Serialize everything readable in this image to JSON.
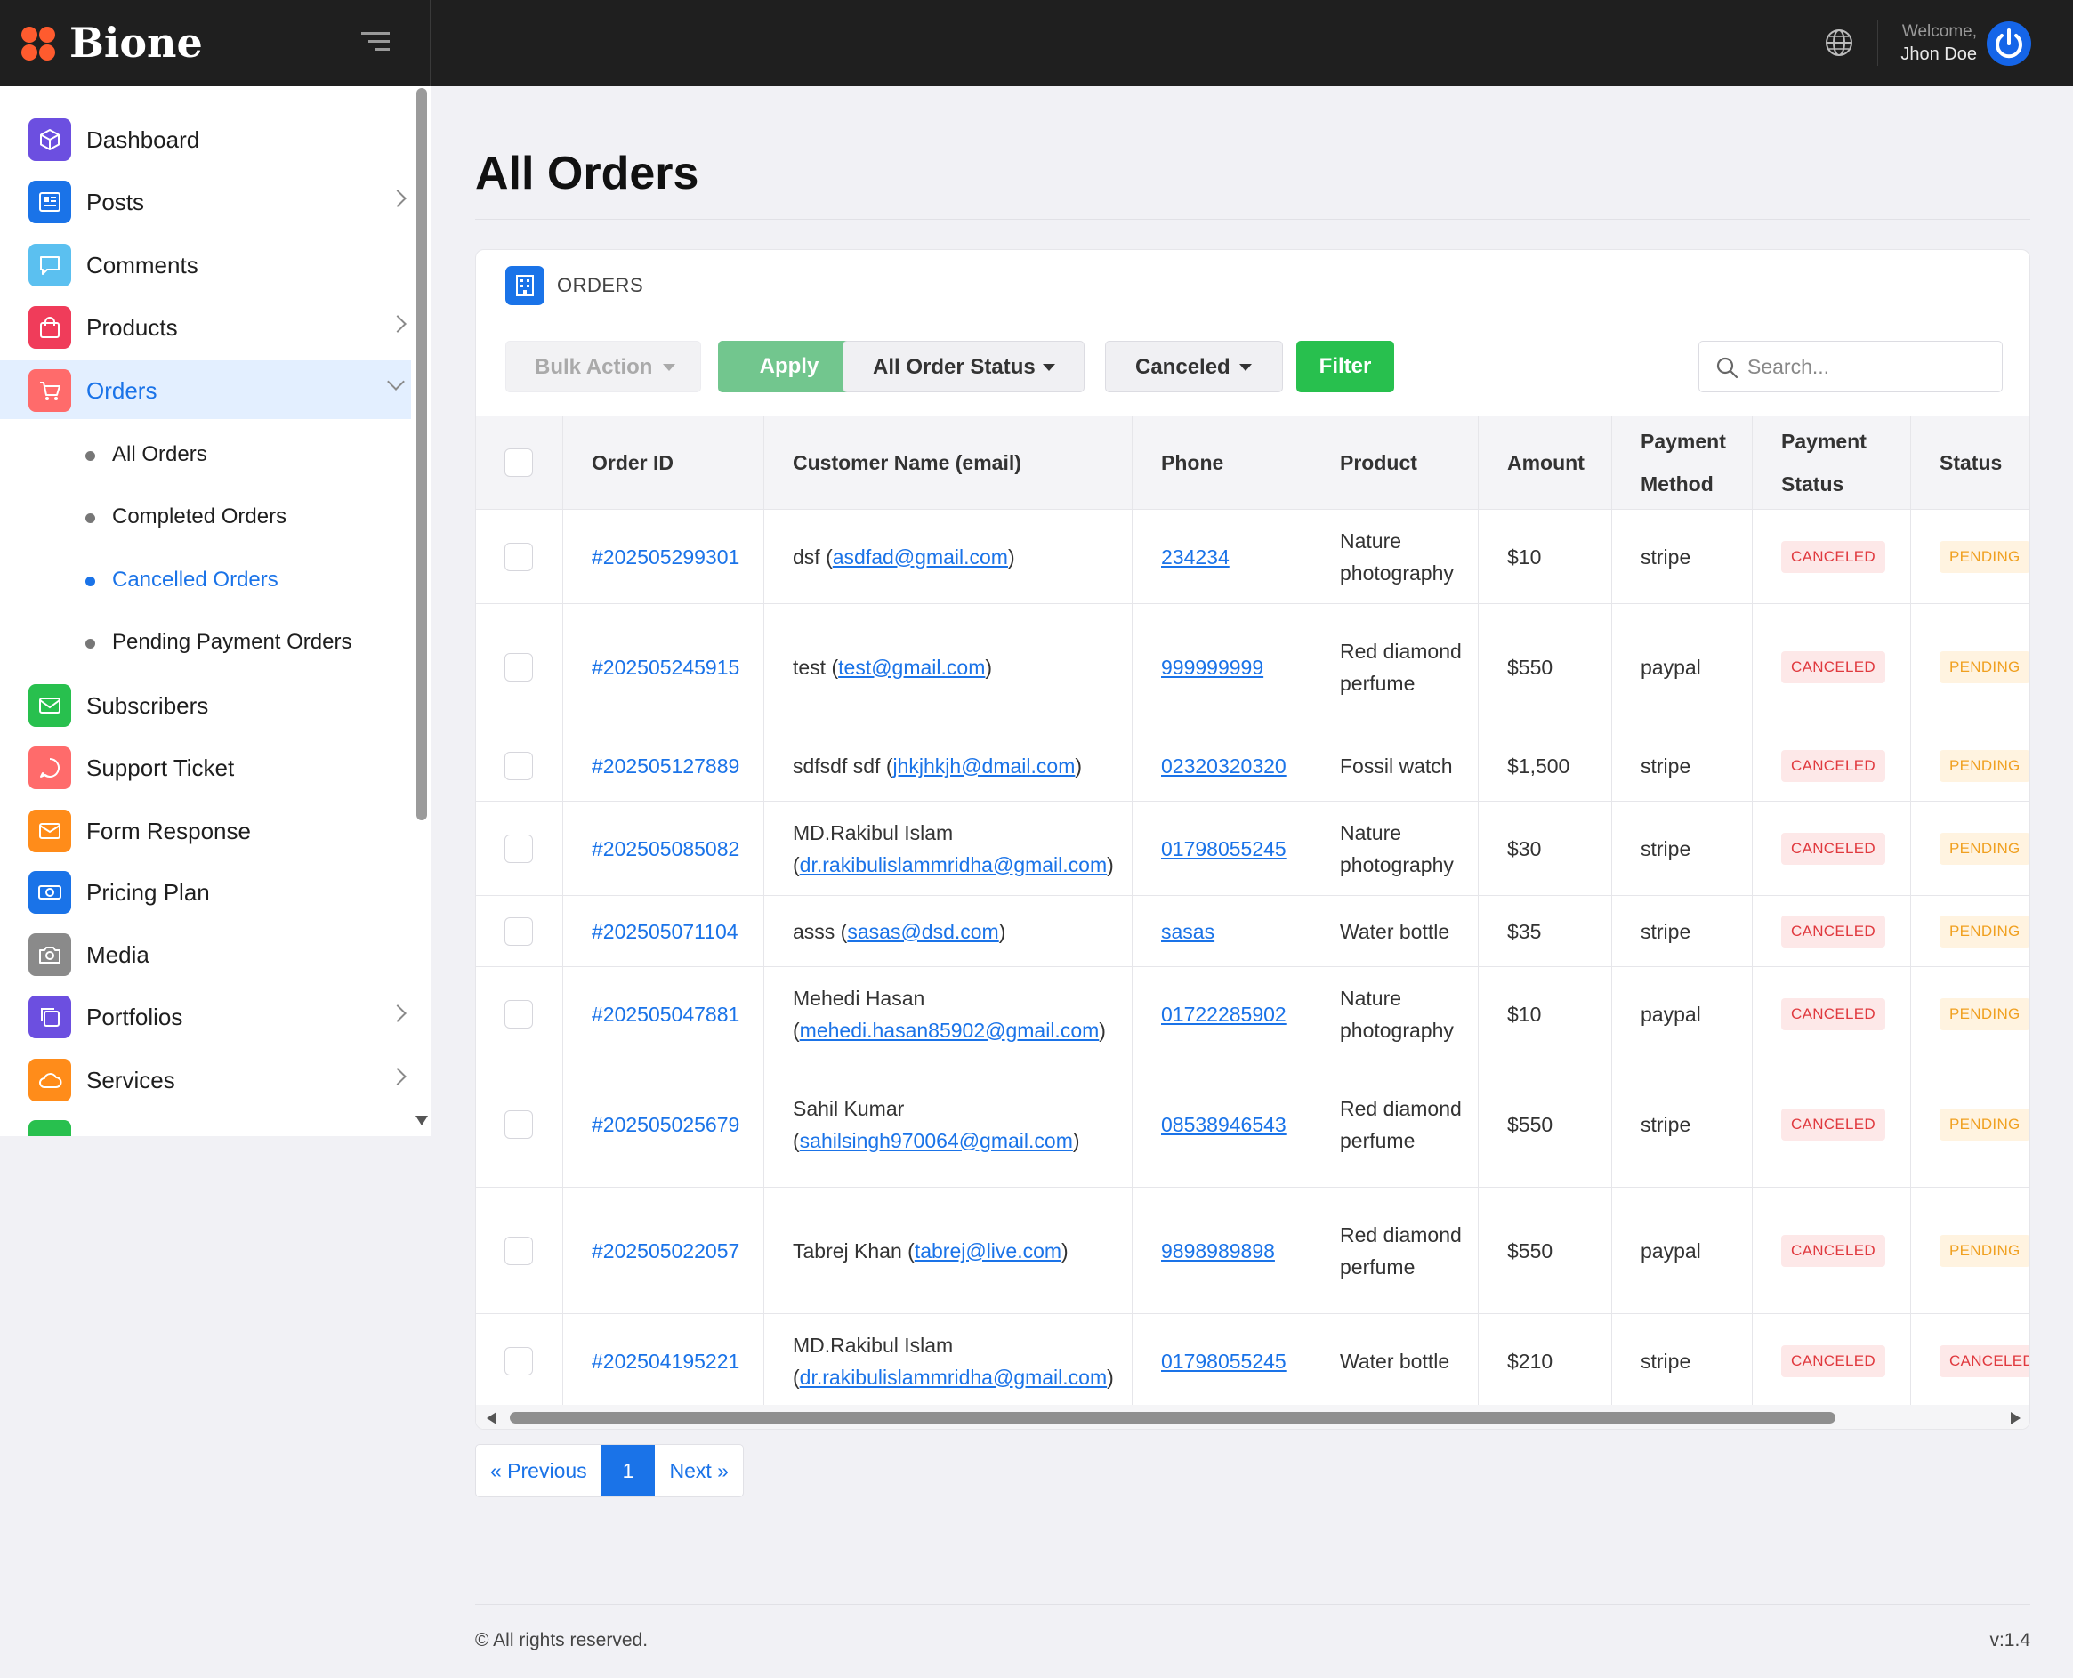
{
  "brand": {
    "name": "Bione"
  },
  "header": {
    "welcome": "Welcome,",
    "user_name": "Jhon Doe"
  },
  "sidebar": {
    "items": [
      {
        "label": "Dashboard",
        "icon": "cube-icon",
        "color": "#6c4fe0"
      },
      {
        "label": "Posts",
        "icon": "newspaper-icon",
        "color": "#1a73e8"
      },
      {
        "label": "Comments",
        "icon": "chat-icon",
        "color": "#5bc0f0"
      },
      {
        "label": "Products",
        "icon": "bag-icon",
        "color": "#f03c5a"
      },
      {
        "label": "Orders",
        "icon": "cart-icon",
        "color": "#ff6b6b"
      },
      {
        "label": "Subscribers",
        "icon": "mail-icon",
        "color": "#28c04e"
      },
      {
        "label": "Support Ticket",
        "icon": "support-icon",
        "color": "#ff6b6b"
      },
      {
        "label": "Form Response",
        "icon": "envelope-icon",
        "color": "#ff8c1a"
      },
      {
        "label": "Pricing Plan",
        "icon": "money-icon",
        "color": "#1a73e8"
      },
      {
        "label": "Media",
        "icon": "camera-icon",
        "color": "#8a8a8a"
      },
      {
        "label": "Portfolios",
        "icon": "copy-icon",
        "color": "#6c4fe0"
      },
      {
        "label": "Services",
        "icon": "cloud-icon",
        "color": "#ff8c1a"
      }
    ],
    "orders_sub": [
      {
        "label": "All Orders"
      },
      {
        "label": "Completed Orders"
      },
      {
        "label": "Cancelled Orders"
      },
      {
        "label": "Pending Payment Orders"
      }
    ]
  },
  "page": {
    "title": "All Orders"
  },
  "card": {
    "title": "ORDERS"
  },
  "toolbar": {
    "bulk_action": "Bulk Action",
    "apply": "Apply",
    "order_status": "All Order Status",
    "payment_filter": "Canceled",
    "filter": "Filter",
    "search_placeholder": "Search..."
  },
  "table": {
    "columns": [
      "Order ID",
      "Customer Name (email)",
      "Phone",
      "Product",
      "Amount",
      "Payment Method",
      "Payment Status",
      "Status"
    ],
    "rows": [
      {
        "id": "#202505299301",
        "name": "dsf",
        "email": "asdfad@gmail.com",
        "phone": "234234",
        "product": "Nature photography",
        "amount": "$10",
        "method": "stripe",
        "pay_status": "CANCELED",
        "status": "PENDING"
      },
      {
        "id": "#202505245915",
        "name": "test",
        "email": "test@gmail.com",
        "phone": "999999999",
        "product": "Red diamond perfume",
        "amount": "$550",
        "method": "paypal",
        "pay_status": "CANCELED",
        "status": "PENDING"
      },
      {
        "id": "#202505127889",
        "name": "sdfsdf sdf",
        "email": "jhkjhkjh@dmail.com",
        "phone": "02320320320",
        "product": "Fossil watch",
        "amount": "$1,500",
        "method": "stripe",
        "pay_status": "CANCELED",
        "status": "PENDING"
      },
      {
        "id": "#202505085082",
        "name": "MD.Rakibul Islam",
        "email": "dr.rakibulislammridha@gmail.com",
        "phone": "01798055245",
        "product": "Nature photography",
        "amount": "$30",
        "method": "stripe",
        "pay_status": "CANCELED",
        "status": "PENDING"
      },
      {
        "id": "#202505071104",
        "name": "asss",
        "email": "sasas@dsd.com",
        "phone": "sasas",
        "product": "Water bottle",
        "amount": "$35",
        "method": "stripe",
        "pay_status": "CANCELED",
        "status": "PENDING"
      },
      {
        "id": "#202505047881",
        "name": "Mehedi Hasan",
        "email": "mehedi.hasan85902@gmail.com",
        "phone": "01722285902",
        "product": "Nature photography",
        "amount": "$10",
        "method": "paypal",
        "pay_status": "CANCELED",
        "status": "PENDING"
      },
      {
        "id": "#202505025679",
        "name": "Sahil Kumar",
        "email": "sahilsingh970064@gmail.com",
        "phone": "08538946543",
        "product": "Red diamond perfume",
        "amount": "$550",
        "method": "stripe",
        "pay_status": "CANCELED",
        "status": "PENDING"
      },
      {
        "id": "#202505022057",
        "name": "Tabrej Khan",
        "email": "tabrej@live.com",
        "phone": "9898989898",
        "product": "Red diamond perfume",
        "amount": "$550",
        "method": "paypal",
        "pay_status": "CANCELED",
        "status": "PENDING"
      },
      {
        "id": "#202504195221",
        "name": "MD.Rakibul Islam",
        "email": "dr.rakibulislammridha@gmail.com",
        "phone": "01798055245",
        "product": "Water bottle",
        "amount": "$210",
        "method": "stripe",
        "pay_status": "CANCELED",
        "status": "CANCELED"
      }
    ]
  },
  "pagination": {
    "prev": "« Previous",
    "current": "1",
    "next": "Next »"
  },
  "footer": {
    "copyright": "© All rights reserved.",
    "version": "v:1.4"
  }
}
